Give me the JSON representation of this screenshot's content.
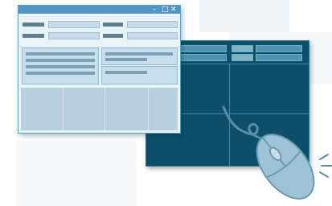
{
  "scene": {
    "background_color": "#ffffff",
    "colors": {
      "light_window_border": "#5d9fc0",
      "titlebar": "#4f96c6",
      "dark_window": "#0d4f68",
      "mouse_body": "#9ec3d6",
      "cable": "#5a8da5"
    }
  },
  "light_window": {
    "icons": {
      "minimize": "minimize-icon",
      "maximize": "maximize-icon",
      "close": "close-icon"
    },
    "minimize_glyph": "–",
    "maximize_glyph": "□",
    "close_glyph": "✕"
  },
  "mouse": {
    "icon": "computer-mouse-icon"
  }
}
